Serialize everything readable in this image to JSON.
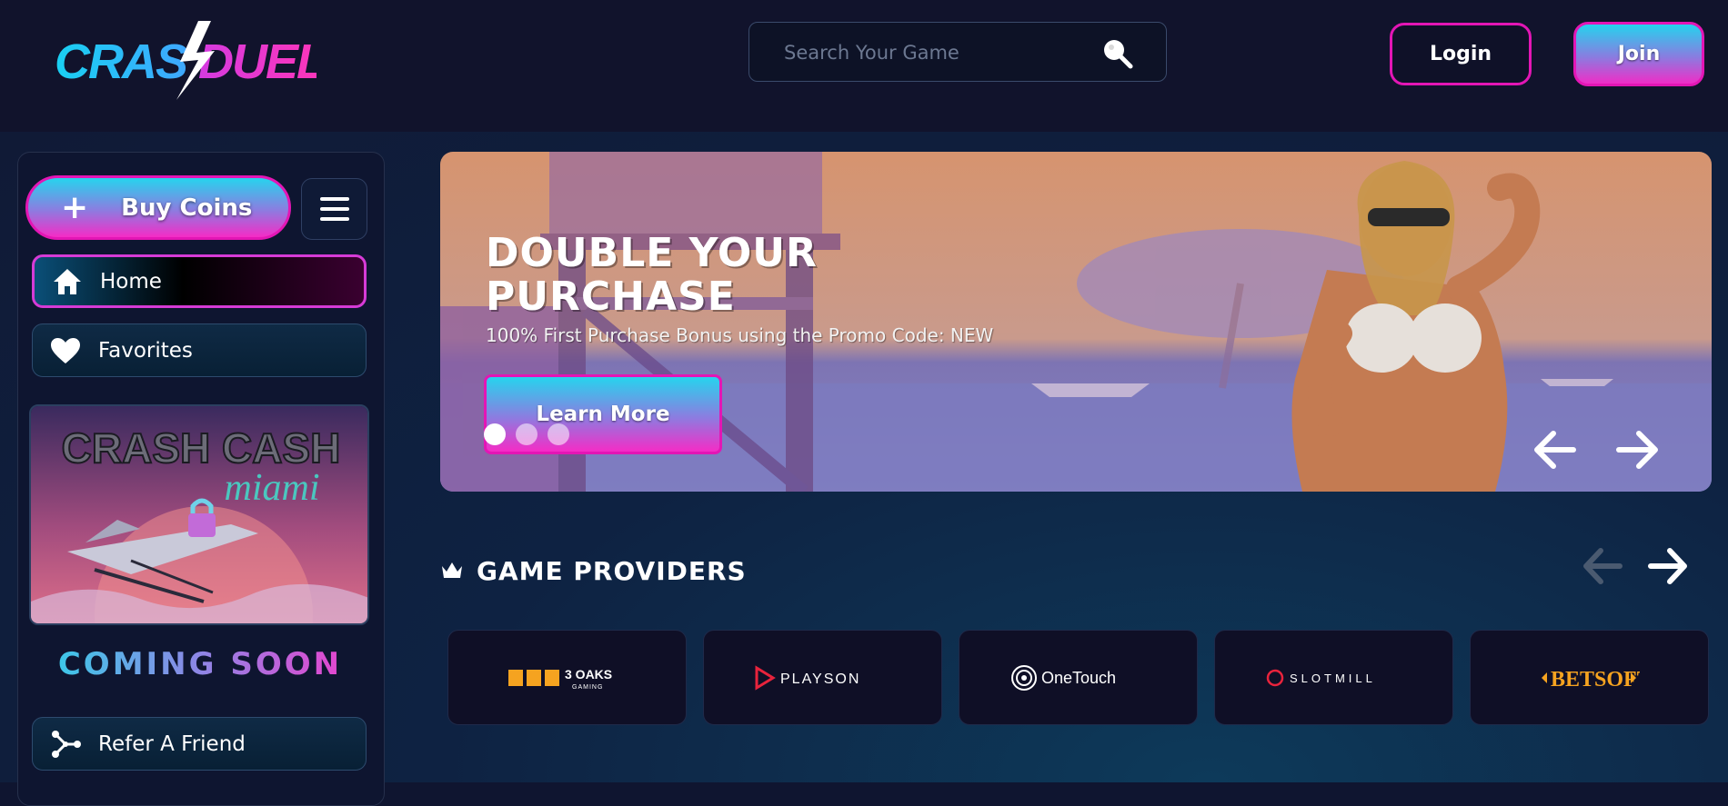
{
  "header": {
    "logo_text": "CRASHDUEL",
    "search_placeholder": "Search Your Game",
    "login_label": "Login",
    "join_label": "Join"
  },
  "sidebar": {
    "buy_coins_label": "Buy Coins",
    "nav": [
      {
        "label": "Home",
        "icon": "home-icon"
      },
      {
        "label": "Favorites",
        "icon": "heart-icon"
      }
    ],
    "promo_card": {
      "title_line1": "CRASH CASH",
      "title_line2": "miami"
    },
    "coming_soon_label": "COMING SOON",
    "refer_label": "Refer A Friend"
  },
  "banner": {
    "title": "DOUBLE YOUR PURCHASE",
    "subtitle": "100% First Purchase Bonus using the Promo Code: NEW",
    "cta_label": "Learn More",
    "slides_count": 3,
    "active_slide": 1
  },
  "providers": {
    "title": "GAME PROVIDERS",
    "items": [
      {
        "name": "3 OAKS",
        "tagline": "GAMING"
      },
      {
        "name": "PLAYSON"
      },
      {
        "name": "OneTouch"
      },
      {
        "name": "SLOTMILL"
      },
      {
        "name": "BETSOFT"
      }
    ]
  },
  "colors": {
    "accent_pink": "#e316b5",
    "accent_cyan": "#26d4ee",
    "header_bg": "#11132c"
  }
}
